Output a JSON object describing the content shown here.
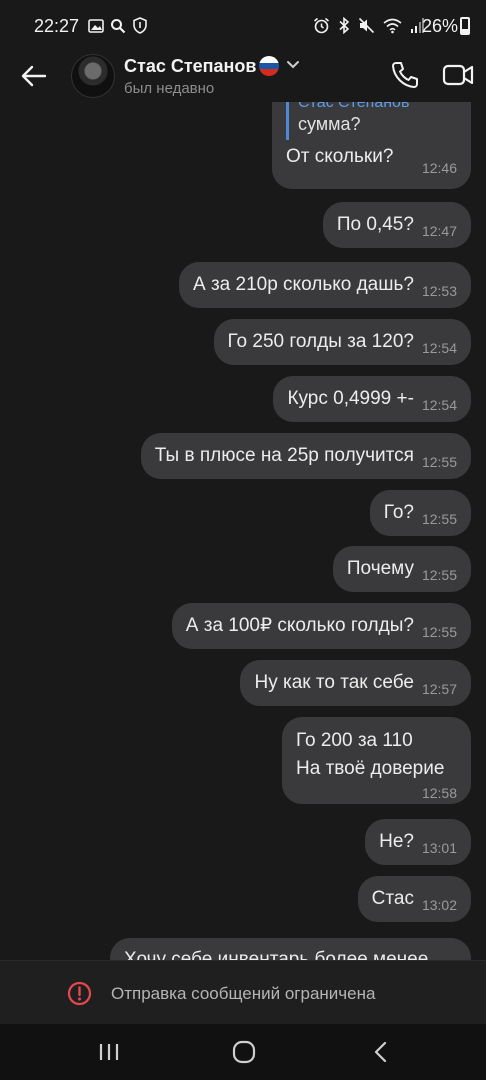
{
  "status_bar": {
    "time": "22:27",
    "battery": "26%",
    "left_icons": [
      "image-icon",
      "search-icon",
      "shield-icon"
    ],
    "right_icons": [
      "alarm-icon",
      "bluetooth-icon",
      "mute-icon",
      "wifi-icon",
      "signal-icon",
      "battery-icon"
    ]
  },
  "header": {
    "contact_name": "Стас Степанов",
    "status": "был недавно",
    "flag_icon": "russia-flag-icon",
    "flag_colors": [
      "#ffffff",
      "#1c57a7",
      "#d52b1e"
    ],
    "back_icon": "arrow-left-icon",
    "call_icon": "phone-icon",
    "video_icon": "video-camera-icon"
  },
  "messages": [
    {
      "reply_name": "Стас Степанов",
      "reply_text": "сумма?",
      "text": "От скольки?",
      "time": "12:46"
    },
    {
      "text": "По 0,45?",
      "time": "12:47"
    },
    {
      "text": "А за 210р сколько дашь?",
      "time": "12:53"
    },
    {
      "text": "Го 250 голды за 120?",
      "time": "12:54"
    },
    {
      "text": "Курс 0,4999 +-",
      "time": "12:54"
    },
    {
      "text": "Ты в плюсе на 25р получится",
      "time": "12:55"
    },
    {
      "text": "Го?",
      "time": "12:55"
    },
    {
      "text": "Почему",
      "time": "12:55"
    },
    {
      "text": "А за 100₽ сколько голды?",
      "time": "12:55"
    },
    {
      "text": "Ну как то так себе",
      "time": "12:57"
    },
    {
      "line1": "Го 200 за 110",
      "line2": "На твоё доверие",
      "time": "12:58"
    },
    {
      "text": "Не?",
      "time": "13:01"
    },
    {
      "text": "Стас",
      "time": "13:02"
    },
    {
      "text": "Хочу себе инвентарь более менее"
    }
  ],
  "restriction": {
    "text": "Отправка сообщений ограничена",
    "icon": "warning-circle-icon",
    "color": "#e5484d"
  },
  "nav": {
    "recents_icon": "recents-icon",
    "home_icon": "home-icon",
    "back_icon": "back-icon"
  }
}
